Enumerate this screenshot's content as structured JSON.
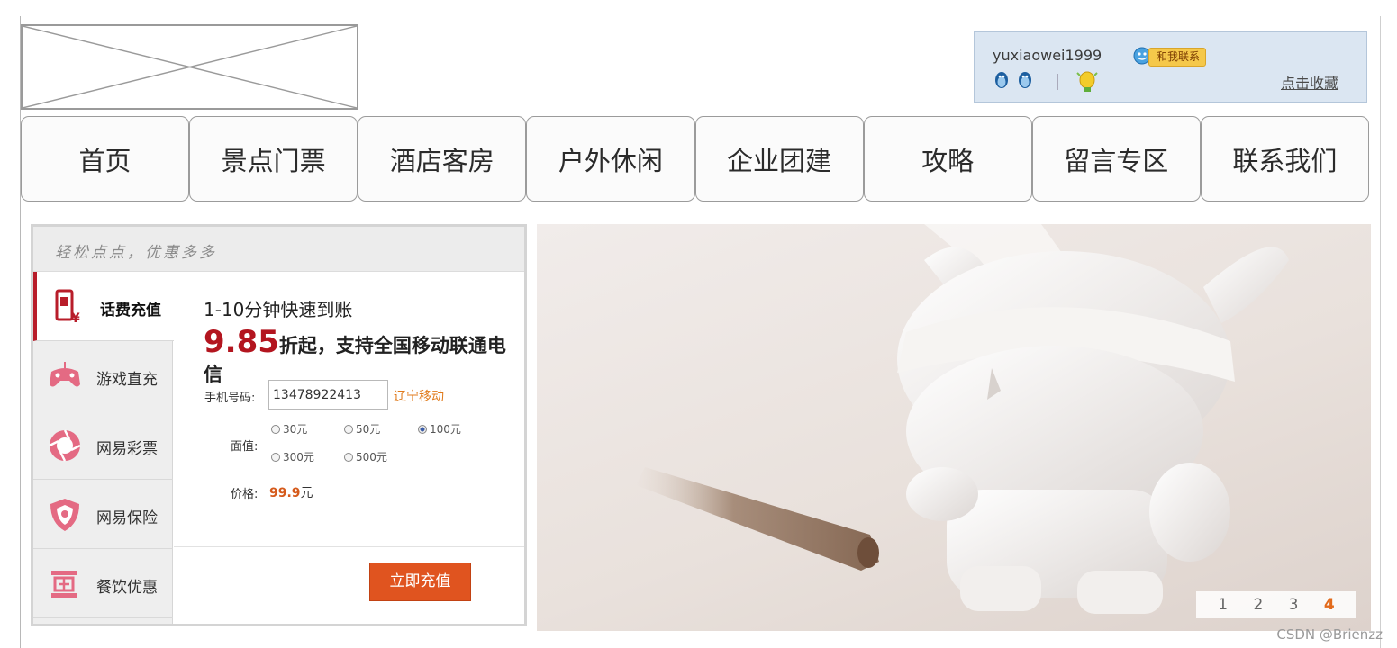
{
  "header": {
    "user": {
      "username": "yuxiaowei1999",
      "contact_label": "和我联系",
      "favorite_label": "点击收藏"
    }
  },
  "nav": {
    "items": [
      {
        "label": "首页"
      },
      {
        "label": "景点门票"
      },
      {
        "label": "酒店客房"
      },
      {
        "label": "户外休闲"
      },
      {
        "label": "企业团建"
      },
      {
        "label": "攻略"
      },
      {
        "label": "留言专区"
      },
      {
        "label": "联系我们"
      }
    ]
  },
  "recharge": {
    "header": "轻松点点，优惠多多",
    "tabs": [
      {
        "label": "话费充值",
        "icon": "phone-icon",
        "active": true
      },
      {
        "label": "游戏直充",
        "icon": "gamepad-icon",
        "active": false
      },
      {
        "label": "网易彩票",
        "icon": "lottery-icon",
        "active": false
      },
      {
        "label": "网易保险",
        "icon": "insurance-icon",
        "active": false
      },
      {
        "label": "餐饮优惠",
        "icon": "dining-icon",
        "active": false
      }
    ],
    "title": "1-10分钟快速到账",
    "discount_value": "9.85",
    "discount_text": "折起，支持全国移动联通电信",
    "phone_label": "手机号码:",
    "phone_value": "13478922413",
    "carrier": "辽宁移动",
    "amount_label": "面值:",
    "amounts": [
      {
        "label": "30元",
        "selected": false
      },
      {
        "label": "50元",
        "selected": false
      },
      {
        "label": "100元",
        "selected": true
      },
      {
        "label": "300元",
        "selected": false
      },
      {
        "label": "500元",
        "selected": false
      }
    ],
    "price_label": "价格:",
    "price_value": "99.9",
    "price_unit": "元",
    "submit_label": "立即充值"
  },
  "banner": {
    "pages": [
      "1",
      "2",
      "3",
      "4"
    ],
    "active_page": "4"
  },
  "watermark": "CSDN @Brienzz",
  "colors": {
    "accent_red": "#b3151f",
    "button_orange": "#e0541f",
    "user_panel_bg": "#dbe6f2",
    "pager_active": "#e26a1b"
  }
}
